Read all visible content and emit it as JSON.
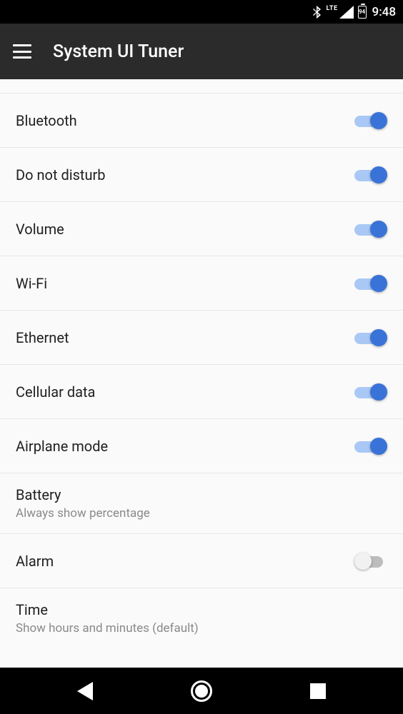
{
  "statusbar": {
    "lte": "LTE",
    "battery_pct": "94",
    "time": "9:48"
  },
  "appbar": {
    "title": "System UI Tuner"
  },
  "rows": [
    {
      "label": "Bluetooth",
      "toggle": "on"
    },
    {
      "label": "Do not disturb",
      "toggle": "on"
    },
    {
      "label": "Volume",
      "toggle": "on"
    },
    {
      "label": "Wi-Fi",
      "toggle": "on"
    },
    {
      "label": "Ethernet",
      "toggle": "on"
    },
    {
      "label": "Cellular data",
      "toggle": "on"
    },
    {
      "label": "Airplane mode",
      "toggle": "on"
    },
    {
      "label": "Battery",
      "secondary": "Always show percentage"
    },
    {
      "label": "Alarm",
      "toggle": "off"
    },
    {
      "label": "Time",
      "secondary": "Show hours and minutes (default)"
    }
  ]
}
